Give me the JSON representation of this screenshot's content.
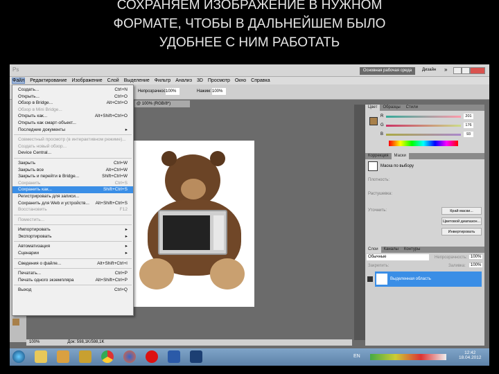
{
  "slide_title": [
    "СОХРАНЯЕМ ИЗОБРАЖЕНИЕ В НУЖНОМ",
    "ФОРМАТЕ, ЧТОБЫ В ДАЛЬНЕЙШЕМ БЫЛО",
    "УДОБНЕЕ С НИМ РАБОТАТЬ"
  ],
  "appbar": {
    "logo": "Ps",
    "workspace": "Основная рабочая среда",
    "design": "Дизайн",
    "more": "»"
  },
  "menubar": [
    "Файл",
    "Редактирование",
    "Изображение",
    "Слой",
    "Выделение",
    "Фильтр",
    "Анализ",
    "3D",
    "Просмотр",
    "Окно",
    "Справка"
  ],
  "options": {
    "opacity_label": "Непрозрачность:",
    "opacity": "100%",
    "flow_label": "Нажим:",
    "flow": "100%"
  },
  "doc_tab": "@ 100% (RGB/8*)",
  "file_menu": [
    {
      "label": "Создать...",
      "sc": "Ctrl+N"
    },
    {
      "label": "Открыть...",
      "sc": "Ctrl+O"
    },
    {
      "label": "Обзор в Bridge...",
      "sc": "Alt+Ctrl+O"
    },
    {
      "label": "Обзор в Mini Bridge...",
      "sc": "",
      "dis": true
    },
    {
      "label": "Открыть как...",
      "sc": "Alt+Shift+Ctrl+O"
    },
    {
      "label": "Открыть как смарт-объект...",
      "sc": ""
    },
    {
      "label": "Последние документы",
      "sc": "▸"
    },
    {
      "sep": true
    },
    {
      "label": "Совместный просмотр (в интерактивном режиме)...",
      "sc": "",
      "dis": true
    },
    {
      "label": "Создать новый обзор...",
      "sc": "",
      "dis": true
    },
    {
      "label": "Device Central...",
      "sc": ""
    },
    {
      "sep": true
    },
    {
      "label": "Закрыть",
      "sc": "Ctrl+W"
    },
    {
      "label": "Закрыть все",
      "sc": "Alt+Ctrl+W"
    },
    {
      "label": "Закрыть и перейти в Bridge...",
      "sc": "Shift+Ctrl+W"
    },
    {
      "label": "Сохранить",
      "sc": "Ctrl+S",
      "dis": true
    },
    {
      "label": "Сохранить как...",
      "sc": "Shift+Ctrl+S",
      "hl": true
    },
    {
      "label": "Регистрировать для записи...",
      "sc": ""
    },
    {
      "label": "Сохранить для Web и устройств...",
      "sc": "Alt+Shift+Ctrl+S"
    },
    {
      "label": "Восстановить",
      "sc": "F12",
      "dis": true
    },
    {
      "sep": true
    },
    {
      "label": "Поместить...",
      "sc": "",
      "dis": true
    },
    {
      "sep": true
    },
    {
      "label": "Импортировать",
      "sc": "▸"
    },
    {
      "label": "Экспортировать",
      "sc": "▸"
    },
    {
      "sep": true
    },
    {
      "label": "Автоматизация",
      "sc": "▸"
    },
    {
      "label": "Сценарии",
      "sc": "▸"
    },
    {
      "sep": true
    },
    {
      "label": "Сведения о файле...",
      "sc": "Alt+Shift+Ctrl+I"
    },
    {
      "sep": true
    },
    {
      "label": "Печатать...",
      "sc": "Ctrl+P"
    },
    {
      "label": "Печать одного экземпляра",
      "sc": "Alt+Shift+Ctrl+P"
    },
    {
      "sep": true
    },
    {
      "label": "Выход",
      "sc": "Ctrl+Q"
    }
  ],
  "color_panel": {
    "tabs": [
      "Цвет",
      "Образцы",
      "Стили"
    ],
    "r_label": "R",
    "g_label": "G",
    "b_label": "B",
    "r": "201",
    "g": "176",
    "b": "93",
    "swatch": "#a8804a"
  },
  "masks_panel": {
    "tabs": [
      "Коррекция",
      "Маски"
    ],
    "title": "Маска по выбору",
    "density": "Плотность:",
    "feather": "Растушевка:",
    "refine": "Уточнить:",
    "btn1": "Край маски...",
    "btn2": "Цветовой диапазон...",
    "btn3": "Инвертировать"
  },
  "layers_panel": {
    "tabs": [
      "Слои",
      "Каналы",
      "Контуры"
    ],
    "blend": "Обычные",
    "opacity_label": "Непрозрачность:",
    "opacity": "100%",
    "lock_label": "Закрепить:",
    "fill_label": "Заливка:",
    "fill": "100%",
    "layer_name": "Выделенная область"
  },
  "status": {
    "zoom": "100%",
    "doc": "Док: 598,1K/598,1K"
  },
  "taskbar": {
    "lang": "EN",
    "time": "12:42",
    "date": "18.04.2012"
  }
}
